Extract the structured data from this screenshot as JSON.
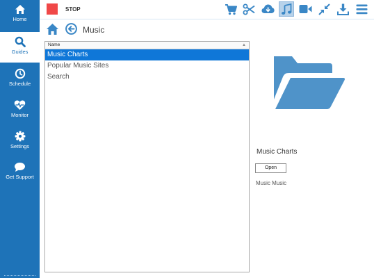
{
  "sidebar": {
    "items": [
      {
        "label": "Home",
        "icon": "home-icon"
      },
      {
        "label": "Guides",
        "icon": "search-icon",
        "active": true
      },
      {
        "label": "Schedule",
        "icon": "clock-icon"
      },
      {
        "label": "Monitor",
        "icon": "heartbeat-icon"
      },
      {
        "label": "Settings",
        "icon": "gear-icon"
      },
      {
        "label": "Get Support",
        "icon": "chat-icon"
      }
    ]
  },
  "toolbar": {
    "stop_label": "STOP",
    "buttons": [
      {
        "icon": "cart-icon"
      },
      {
        "icon": "scissors-icon"
      },
      {
        "icon": "cloud-download-icon"
      },
      {
        "icon": "music-icon",
        "active": true
      },
      {
        "icon": "video-icon"
      },
      {
        "icon": "compress-icon"
      },
      {
        "icon": "download-icon"
      },
      {
        "icon": "menu-icon"
      }
    ]
  },
  "nav": {
    "title": "Music"
  },
  "list": {
    "column_header": "Name",
    "rows": [
      {
        "label": "Music Charts",
        "selected": true
      },
      {
        "label": "Popular Music Sites"
      },
      {
        "label": "Search"
      }
    ]
  },
  "preview": {
    "icon": "folder-open-icon",
    "title": "Music Charts",
    "open_label": "Open",
    "description": "Music Music"
  },
  "colors": {
    "sidebar_bg": "#1e73b8",
    "accent": "#3a87c6",
    "stop_red": "#f04848",
    "selection": "#0f77d8",
    "folder": "#4f93c9"
  }
}
